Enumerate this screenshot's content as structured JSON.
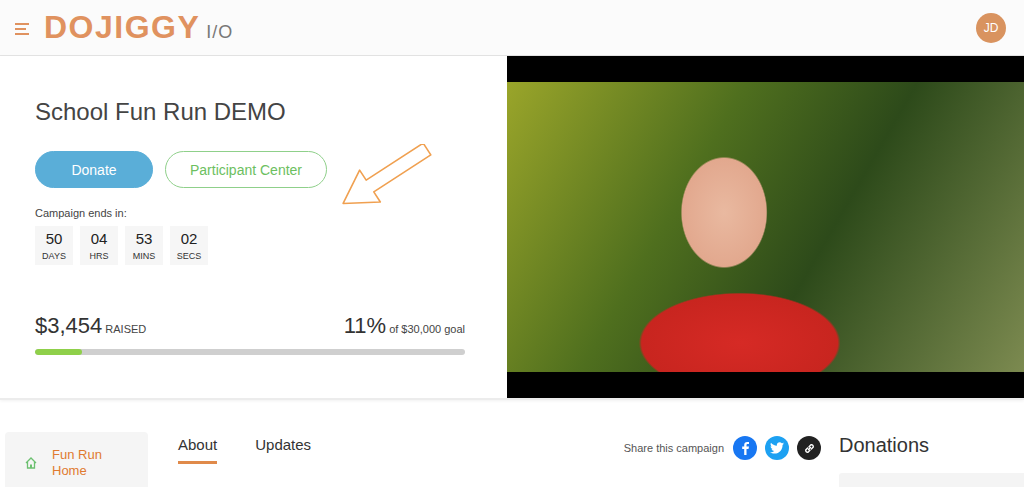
{
  "header": {
    "logo": "DOJIGGY",
    "logo_suffix": "I/O",
    "avatar": "JD"
  },
  "campaign": {
    "title": "School Fun Run DEMO",
    "buttons": [
      {
        "label": "Donate",
        "kind": "primary"
      },
      {
        "label": "Participant Center",
        "kind": "outline"
      }
    ],
    "countdown_label": "Campaign ends in:",
    "countdown": [
      {
        "value": "50",
        "unit": "DAYS"
      },
      {
        "value": "04",
        "unit": "HRS"
      },
      {
        "value": "53",
        "unit": "MINS"
      },
      {
        "value": "02",
        "unit": "SECS"
      }
    ],
    "raised": "$3,454",
    "raised_label": "RAISED",
    "percent": "11%",
    "goal": "of $30,000 goal",
    "level": 0.11
  },
  "sidebar": {
    "items": [
      {
        "label": "Fun Run Home",
        "selected": true
      }
    ]
  },
  "tabs": [
    {
      "label": "About",
      "selected": true
    },
    {
      "label": "Updates",
      "selected": false
    }
  ],
  "share": {
    "label": "Share this campaign",
    "buttons": [
      {
        "kind": "facebook",
        "color": "#1877f2"
      },
      {
        "kind": "twitter",
        "color": "#1da1f2"
      },
      {
        "kind": "link",
        "color": "#222222"
      }
    ]
  },
  "donations": {
    "title": "Donations"
  }
}
